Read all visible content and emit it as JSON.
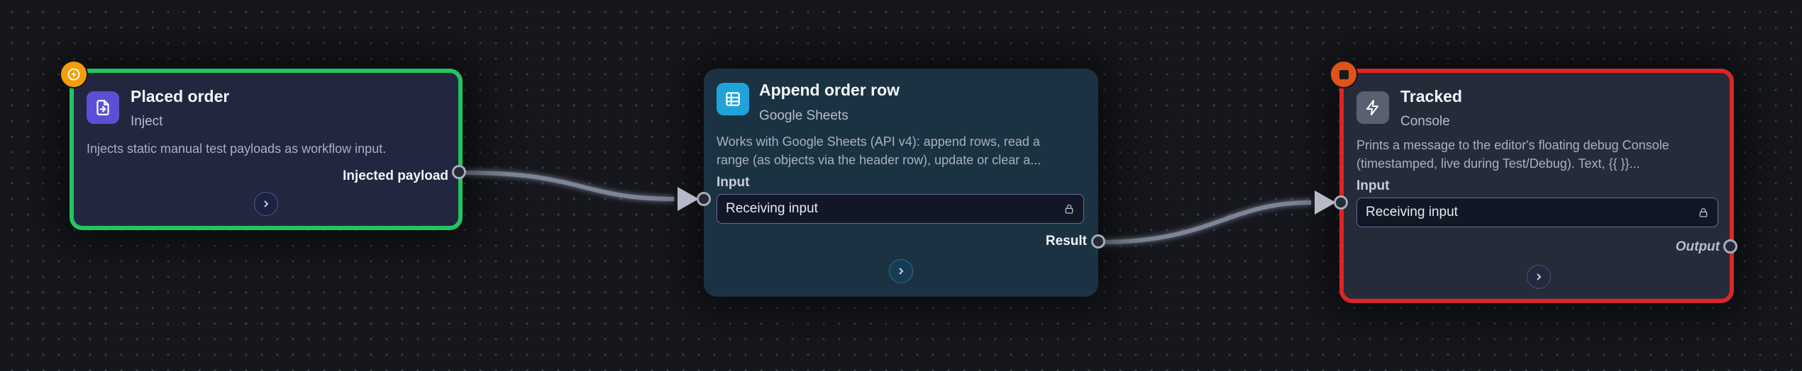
{
  "canvas": {
    "colors": {
      "background": "#15171c",
      "wire": "#7d8599",
      "success": "#22c55e",
      "error": "#dc2626"
    }
  },
  "nodes": [
    {
      "title": "Placed order",
      "subtitle": "Inject",
      "description": "Injects static manual test payloads as workflow input.",
      "output_label": "Injected payload",
      "icon": "file-import-icon",
      "badge": "lightning-badge-icon",
      "status": "success"
    },
    {
      "title": "Append order row",
      "subtitle": "Google Sheets",
      "description_line1": "Works with Google Sheets (API v4): append rows, read a",
      "description_line2": "range (as objects via the header row), update or clear a...",
      "input_section": "Input",
      "input_value": "Receiving input",
      "output_label": "Result",
      "icon": "table-grid-icon"
    },
    {
      "title": "Tracked",
      "subtitle": "Console",
      "description_line1": "Prints a message to the editor's floating debug Console",
      "description_line2": "(timestamped, live during Test/Debug). Text, {{ }}...",
      "input_section": "Input",
      "input_value": "Receiving input",
      "output_label": "Output",
      "icon": "lightning-icon",
      "badge": "stop-badge-icon",
      "status": "error"
    }
  ]
}
